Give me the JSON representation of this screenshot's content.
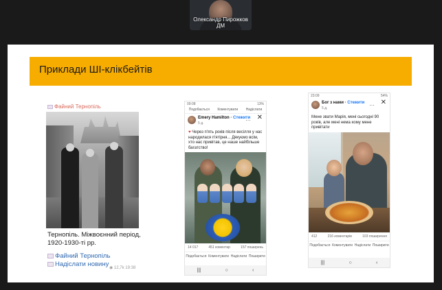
{
  "meeting": {
    "speaker_name": "Олександр Пирожков ДМ"
  },
  "slide": {
    "title": "Приклади ШІ-клікбейтів"
  },
  "example1": {
    "channel": "Файний Тернопіль",
    "caption": "Тернопіль. Міжвоєнний період, 1920-1930-ті рр.",
    "link1": "Файний Тернопіль",
    "link2": "Надіслати новину",
    "meta": "12,7k 19:38"
  },
  "example2": {
    "status_left": "09:08",
    "status_right": "13%",
    "top_reactions": [
      "Подобається",
      "Коментувати",
      "Надіслати"
    ],
    "author": "Emery Hamilton",
    "follow": "Стежити",
    "time": "5 д.",
    "text": "Через п'ять років після весілля у нас народилася п'ятірня... Дякуємо всім, хто нас привітав, це наше найбільше багатство!",
    "likes": "14 017",
    "comments": "451 коментар",
    "shares": "157 поширень",
    "actions": [
      "Подобається",
      "Коментувати",
      "Надіслати",
      "Поширити"
    ]
  },
  "example3": {
    "status_left": "23:09",
    "status_right": "54%",
    "author": "Бог з нами",
    "follow": "Стежити",
    "time": "5 д.",
    "text": "Мене звати Марія, мені сьогодні 90 років, але мені нема кому мене привітати",
    "likes": "412",
    "comments": "216 коментарів",
    "shares": "103 поширення",
    "actions": [
      "Подобається",
      "Коментувати",
      "Надіслати",
      "Поширити"
    ]
  }
}
